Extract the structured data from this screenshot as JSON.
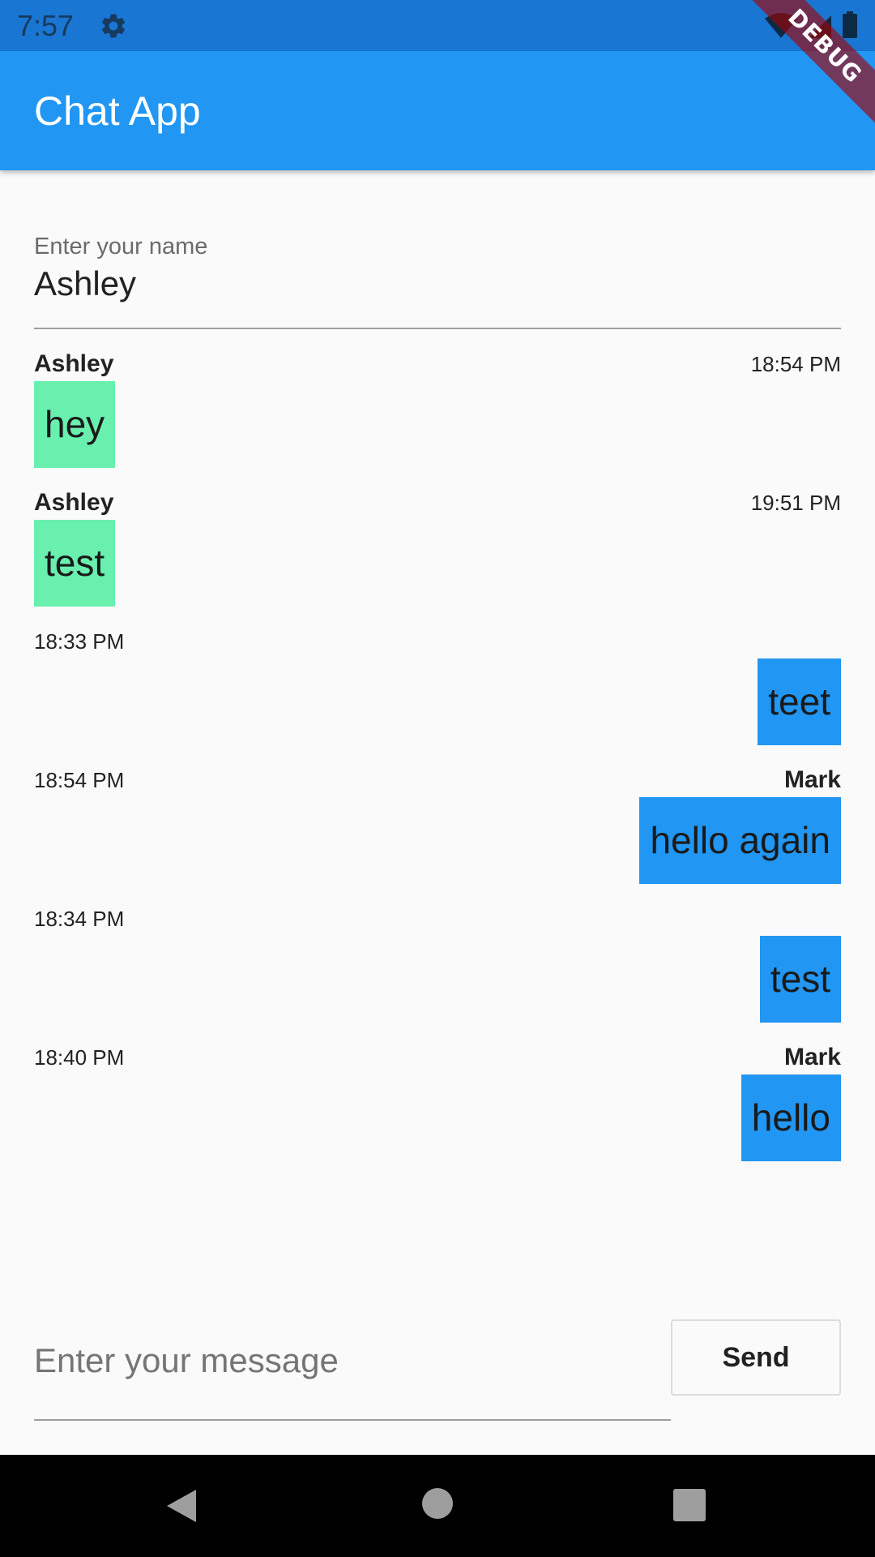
{
  "status_bar": {
    "time": "7:57",
    "icons": [
      "gear-icon",
      "wifi-icon",
      "signal-icon",
      "battery-icon"
    ]
  },
  "app_bar": {
    "title": "Chat App"
  },
  "debug_banner": "DEBUG",
  "name_field": {
    "label": "Enter your name",
    "value": "Ashley"
  },
  "messages": [
    {
      "sender": "Ashley",
      "time": "18:54 PM",
      "text": "hey",
      "mine": true
    },
    {
      "sender": "Ashley",
      "time": "19:51 PM",
      "text": "test",
      "mine": true
    },
    {
      "sender": "",
      "time": "18:33 PM",
      "text": "teet",
      "mine": false
    },
    {
      "sender": "Mark",
      "time": "18:54 PM",
      "text": "hello again",
      "mine": false
    },
    {
      "sender": "",
      "time": "18:34 PM",
      "text": "test",
      "mine": false
    },
    {
      "sender": "Mark",
      "time": "18:40 PM",
      "text": "hello",
      "mine": false
    }
  ],
  "compose": {
    "placeholder": "Enter your message",
    "send_label": "Send"
  },
  "colors": {
    "status_bar": "#1976d2",
    "app_bar": "#2196f3",
    "own_bubble": "#69f0ae",
    "other_bubble": "#2196f3",
    "background": "#fafafa"
  },
  "nav_bar": {
    "icons": [
      "back-icon",
      "home-icon",
      "recents-icon"
    ]
  }
}
